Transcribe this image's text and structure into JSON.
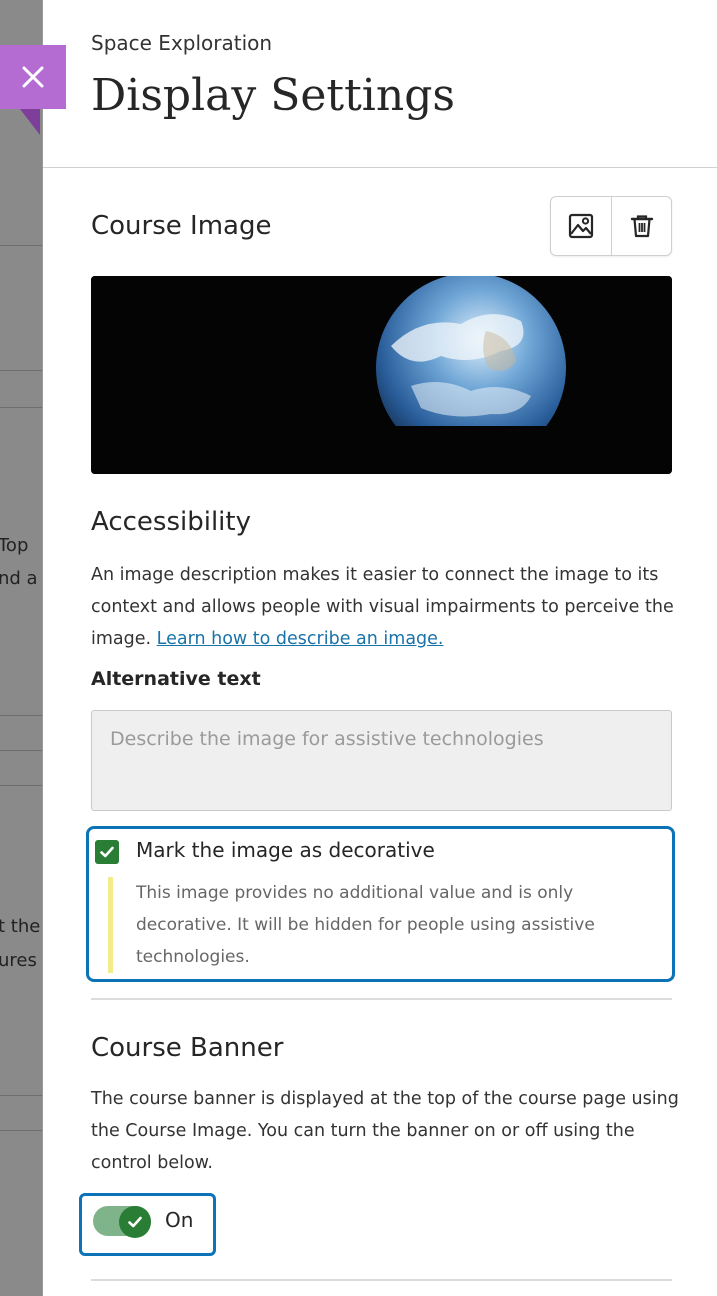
{
  "background_page": {
    "fragments": [
      "Top",
      "nd a",
      "t the",
      "ures"
    ]
  },
  "header": {
    "course_name": "Space Exploration",
    "title": "Display Settings",
    "close_label": "Close"
  },
  "course_image": {
    "heading": "Course Image",
    "replace_icon": "image-icon",
    "delete_icon": "trash-icon"
  },
  "accessibility": {
    "heading": "Accessibility",
    "description": "An image description makes it easier to connect the image to its context and allows people with visual impairments to perceive the image.",
    "link_text": "Learn how to describe an image.",
    "alt_label": "Alternative text",
    "alt_placeholder": "Describe the image for assistive technologies",
    "alt_value": "",
    "decorative": {
      "checked": true,
      "label": "Mark the image as decorative",
      "hint": "This image provides no additional value and is only decorative. It will be hidden for people using assistive technologies."
    }
  },
  "banner": {
    "heading": "Course Banner",
    "description": "The course banner is displayed at the top of the course page using the Course Image. You can turn the banner on or off using the control below.",
    "toggle_on": true,
    "toggle_label": "On"
  },
  "colors": {
    "accent_purple": "#b46cd2",
    "focus_blue": "#0c73b8",
    "check_green": "#2a7d34",
    "hint_bar": "#f4ec8a",
    "link_blue": "#1a73a8"
  }
}
